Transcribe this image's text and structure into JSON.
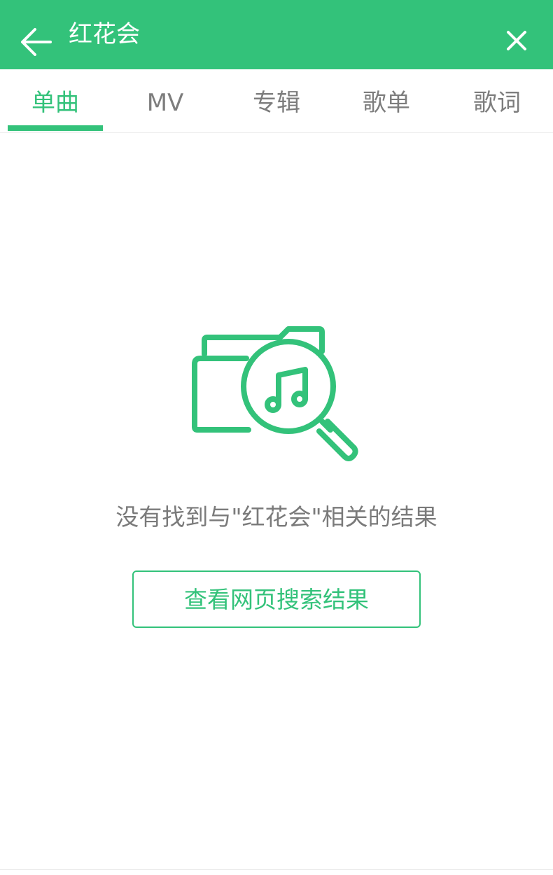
{
  "header": {
    "title": "红花会",
    "back_icon": "arrow-left-icon",
    "close_icon": "close-icon",
    "color": "#33c27a"
  },
  "tabs": [
    {
      "label": "单曲",
      "active": true
    },
    {
      "label": "MV",
      "active": false
    },
    {
      "label": "专辑",
      "active": false
    },
    {
      "label": "歌单",
      "active": false
    },
    {
      "label": "歌词",
      "active": false
    }
  ],
  "empty_state": {
    "icon": "music-folder-search-icon",
    "message": "没有找到与\"红花会\"相关的结果",
    "button_label": "查看网页搜索结果"
  },
  "colors": {
    "accent": "#33c27a",
    "inactive_text": "#7d7d7d",
    "message_text": "#7a7a7a"
  }
}
